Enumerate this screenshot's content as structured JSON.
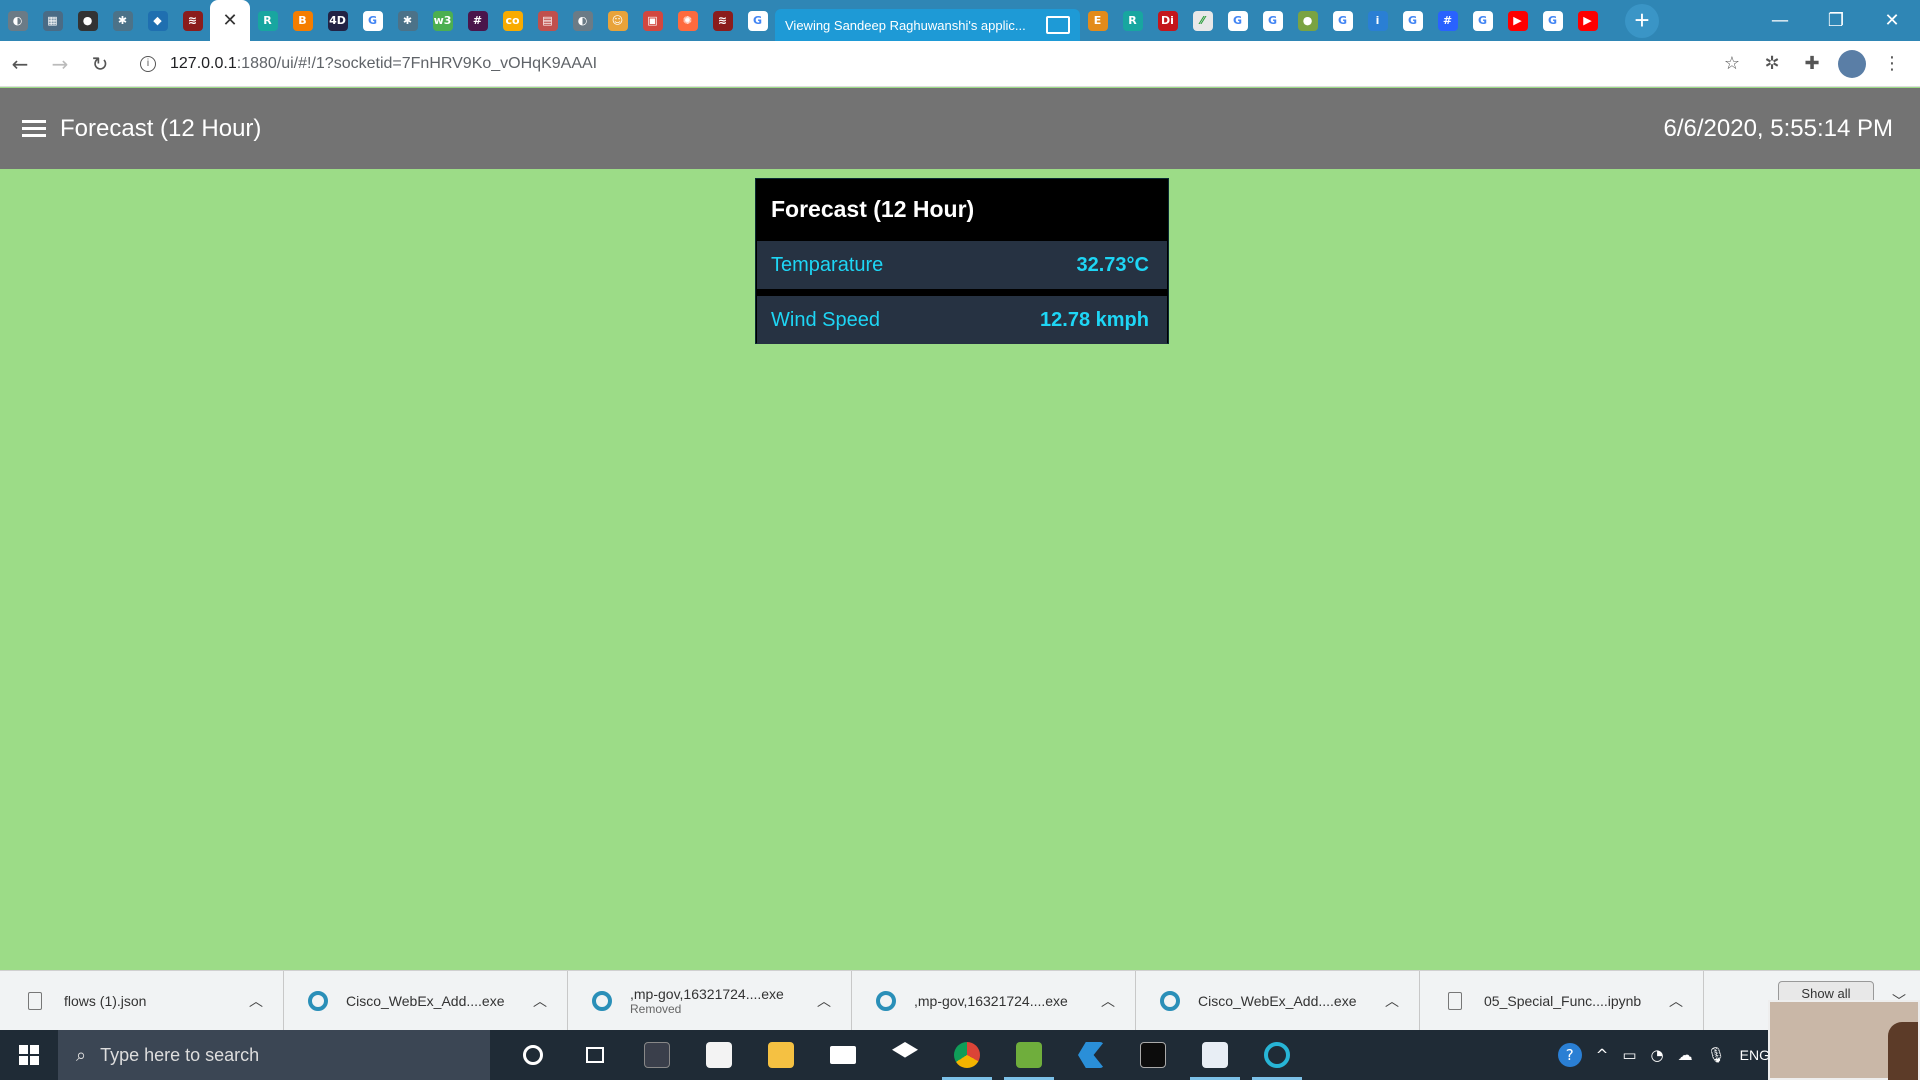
{
  "browser": {
    "tabs": [
      {
        "icon": "chrome-icon",
        "color": "#6b7b86",
        "glyph": "◐"
      },
      {
        "icon": "notes-icon",
        "color": "#4a6b85",
        "glyph": "▦"
      },
      {
        "icon": "github-icon",
        "color": "#333333",
        "glyph": "●"
      },
      {
        "icon": "mindmap-icon",
        "color": "#4c7288",
        "glyph": "✱"
      },
      {
        "icon": "vscode-icon",
        "color": "#1f6fb0",
        "glyph": "◆"
      },
      {
        "icon": "redhat-icon",
        "color": "#8b1c1c",
        "glyph": "≋"
      }
    ],
    "tabs_after_active": [
      {
        "icon": "researchgate-icon",
        "color": "#18a6a0",
        "glyph": "R"
      },
      {
        "icon": "blogger-icon",
        "color": "#f57d00",
        "glyph": "B"
      },
      {
        "icon": "4d-icon",
        "color": "#222244",
        "glyph": "4D"
      },
      {
        "icon": "google-icon",
        "color": "#ffffff",
        "glyph": "G"
      },
      {
        "icon": "mindmap-icon",
        "color": "#4c7288",
        "glyph": "✱"
      },
      {
        "icon": "w3-icon",
        "color": "#4caf50",
        "glyph": "w3"
      },
      {
        "icon": "slack-icon",
        "color": "#4a154b",
        "glyph": "#"
      },
      {
        "icon": "colab-icon",
        "color": "#f9ab00",
        "glyph": "co"
      },
      {
        "icon": "calendar-icon",
        "color": "#c0504d",
        "glyph": "▤"
      },
      {
        "icon": "chrome-icon",
        "color": "#6b7b86",
        "glyph": "◐"
      },
      {
        "icon": "avatar-icon",
        "color": "#e8a33a",
        "glyph": "☺"
      },
      {
        "icon": "puzzle-icon",
        "color": "#d2473f",
        "glyph": "▣"
      },
      {
        "icon": "star-icon",
        "color": "#ff6a3d",
        "glyph": "✺"
      },
      {
        "icon": "redhat-icon",
        "color": "#8b1c1c",
        "glyph": "≋"
      },
      {
        "icon": "google-icon",
        "color": "#ffffff",
        "glyph": "G"
      }
    ],
    "tabs_trailing": [
      {
        "icon": "e-icon",
        "color": "#e38b1b",
        "glyph": "E"
      },
      {
        "icon": "researchgate-icon",
        "color": "#18a6a0",
        "glyph": "R"
      },
      {
        "icon": "di-icon",
        "color": "#c4161c",
        "glyph": "Di"
      },
      {
        "icon": "edit-icon",
        "color": "#e8e8e8",
        "glyph": "⁄⁄"
      },
      {
        "icon": "google-icon",
        "color": "#ffffff",
        "glyph": "G"
      },
      {
        "icon": "google-icon",
        "color": "#ffffff",
        "glyph": "G"
      },
      {
        "icon": "android-icon",
        "color": "#7aa342",
        "glyph": "●"
      },
      {
        "icon": "google-icon",
        "color": "#ffffff",
        "glyph": "G"
      },
      {
        "icon": "info-icon",
        "color": "#2a7fd4",
        "glyph": "i"
      },
      {
        "icon": "google-icon",
        "color": "#ffffff",
        "glyph": "G"
      },
      {
        "icon": "hashnode-icon",
        "color": "#2962ff",
        "glyph": "#"
      },
      {
        "icon": "google-icon",
        "color": "#ffffff",
        "glyph": "G"
      },
      {
        "icon": "youtube-icon",
        "color": "#ff0000",
        "glyph": "▶"
      },
      {
        "icon": "google-icon",
        "color": "#ffffff",
        "glyph": "G"
      },
      {
        "icon": "youtube-icon",
        "color": "#ff0000",
        "glyph": "▶"
      }
    ],
    "sharing_tab_title": "Viewing Sandeep Raghuwanshi's applic...",
    "url_host": "127.0.0.1",
    "url_path": ":1880/ui/#!/1?socketid=7FnHRV9Ko_vOHqK9AAAI"
  },
  "app": {
    "title": "Forecast (12 Hour)",
    "datetime": "6/6/2020, 5:55:14 PM",
    "background": "#9cdc87"
  },
  "widget": {
    "title": "Forecast (12 Hour)",
    "rows": [
      {
        "label": "Temparature",
        "value": "32.73°C"
      },
      {
        "label": "Wind Speed",
        "value": "12.78 kmph"
      }
    ],
    "accent": "#1ed6f5"
  },
  "downloads": {
    "items": [
      {
        "name": "flows (1).json",
        "sub": "",
        "icon": "file-icon"
      },
      {
        "name": "Cisco_WebEx_Add....exe",
        "sub": "",
        "icon": "webex-icon"
      },
      {
        "name": ",mp-gov,16321724....exe",
        "sub": "Removed",
        "icon": "webex-icon"
      },
      {
        "name": ",mp-gov,16321724....exe",
        "sub": "",
        "icon": "webex-icon"
      },
      {
        "name": "Cisco_WebEx_Add....exe",
        "sub": "",
        "icon": "webex-icon"
      },
      {
        "name": "05_Special_Func....ipynb",
        "sub": "",
        "icon": "file-icon"
      }
    ],
    "show_all": "Show all"
  },
  "taskbar": {
    "search_placeholder": "Type here to search",
    "language": "ENG"
  }
}
